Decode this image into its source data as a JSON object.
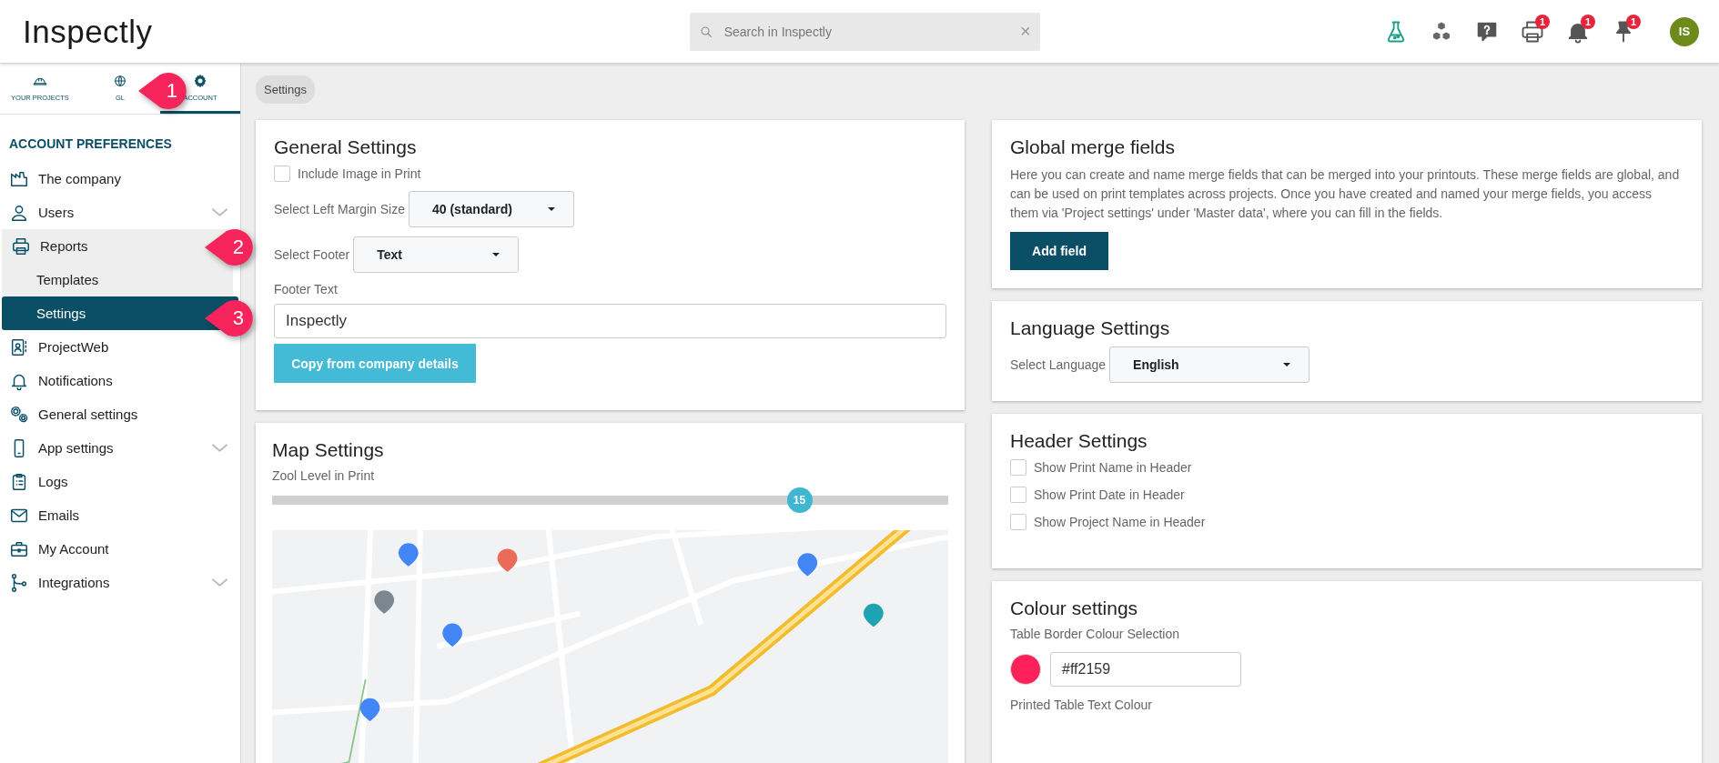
{
  "topbar": {
    "logo": "Inspectly",
    "search": {
      "placeholder": "Search in Inspectly",
      "clear": "×"
    },
    "icons": [
      {
        "kind": "flask"
      },
      {
        "kind": "cubes"
      },
      {
        "kind": "help"
      },
      {
        "kind": "printer",
        "badge": "1"
      },
      {
        "kind": "bell",
        "badge": "1"
      },
      {
        "kind": "pin",
        "badge": "1"
      }
    ],
    "avatar": "IS"
  },
  "sidebar": {
    "tabs": [
      {
        "label": "YOUR PROJECTS",
        "selected": false
      },
      {
        "label": "GL",
        "selected": false
      },
      {
        "label": "ACCOUNT",
        "selected": true
      }
    ],
    "heading": "ACCOUNT PREFERENCES",
    "items": [
      {
        "label": "The company",
        "selected": false
      },
      {
        "label": "Users",
        "selected": false,
        "expanded": false
      },
      {
        "label": "Reports",
        "selected": false,
        "expanded": true,
        "children": [
          {
            "label": "Templates",
            "selected": false
          },
          {
            "label": "Settings",
            "selected": true
          }
        ]
      },
      {
        "label": "ProjectWeb",
        "selected": false
      },
      {
        "label": "Notifications",
        "selected": false
      },
      {
        "label": "General settings",
        "selected": false
      },
      {
        "label": "App settings",
        "selected": false,
        "expanded": false
      },
      {
        "label": "Logs",
        "selected": false
      },
      {
        "label": "Emails",
        "selected": false
      },
      {
        "label": "My Account",
        "selected": false
      },
      {
        "label": "Integrations",
        "selected": false,
        "expanded": false
      }
    ]
  },
  "breadcrumb": "Settings",
  "general_settings": {
    "title": "General Settings",
    "include_image": {
      "label": "Include Image in Print",
      "checked": false
    },
    "margin_select": {
      "label": "Select Left Margin Size",
      "value": "40 (standard)"
    },
    "footer_select": {
      "label": "Select Footer",
      "value": "Text"
    },
    "footer_text": {
      "label": "Footer Text",
      "value": "Inspectly"
    },
    "button": "Copy from company details"
  },
  "map_settings": {
    "title": "Map Settings",
    "slider": {
      "label": "Zool Level in Print",
      "level": 0.78,
      "reading": "15"
    }
  },
  "global_merge_fields": {
    "title": "Global merge fields",
    "description": "Here you can create and name merge fields that can be merged into your printouts. These merge fields are global, and can be used on print templates across projects. Once you have created and named your merge fields, you access them via 'Project settings' under 'Master data', where you can fill in the fields.",
    "button": "Add field"
  },
  "language_settings": {
    "title": "Language Settings",
    "select": {
      "label": "Select Language",
      "value": "English"
    }
  },
  "header_settings": {
    "title": "Header Settings",
    "checkboxes": [
      {
        "label": "Show Print Name in Header",
        "checked": false
      },
      {
        "label": "Show Print Date in Header",
        "checked": false
      },
      {
        "label": "Show Project Name in Header",
        "checked": false
      }
    ]
  },
  "colour_settings": {
    "title": "Colour settings",
    "border_label": "Table Border Colour Selection",
    "border_color": "#ff2159",
    "text_label": "Printed Table Text Colour"
  },
  "callouts": [
    {
      "label": "1"
    },
    {
      "label": "2"
    },
    {
      "label": "3"
    }
  ]
}
